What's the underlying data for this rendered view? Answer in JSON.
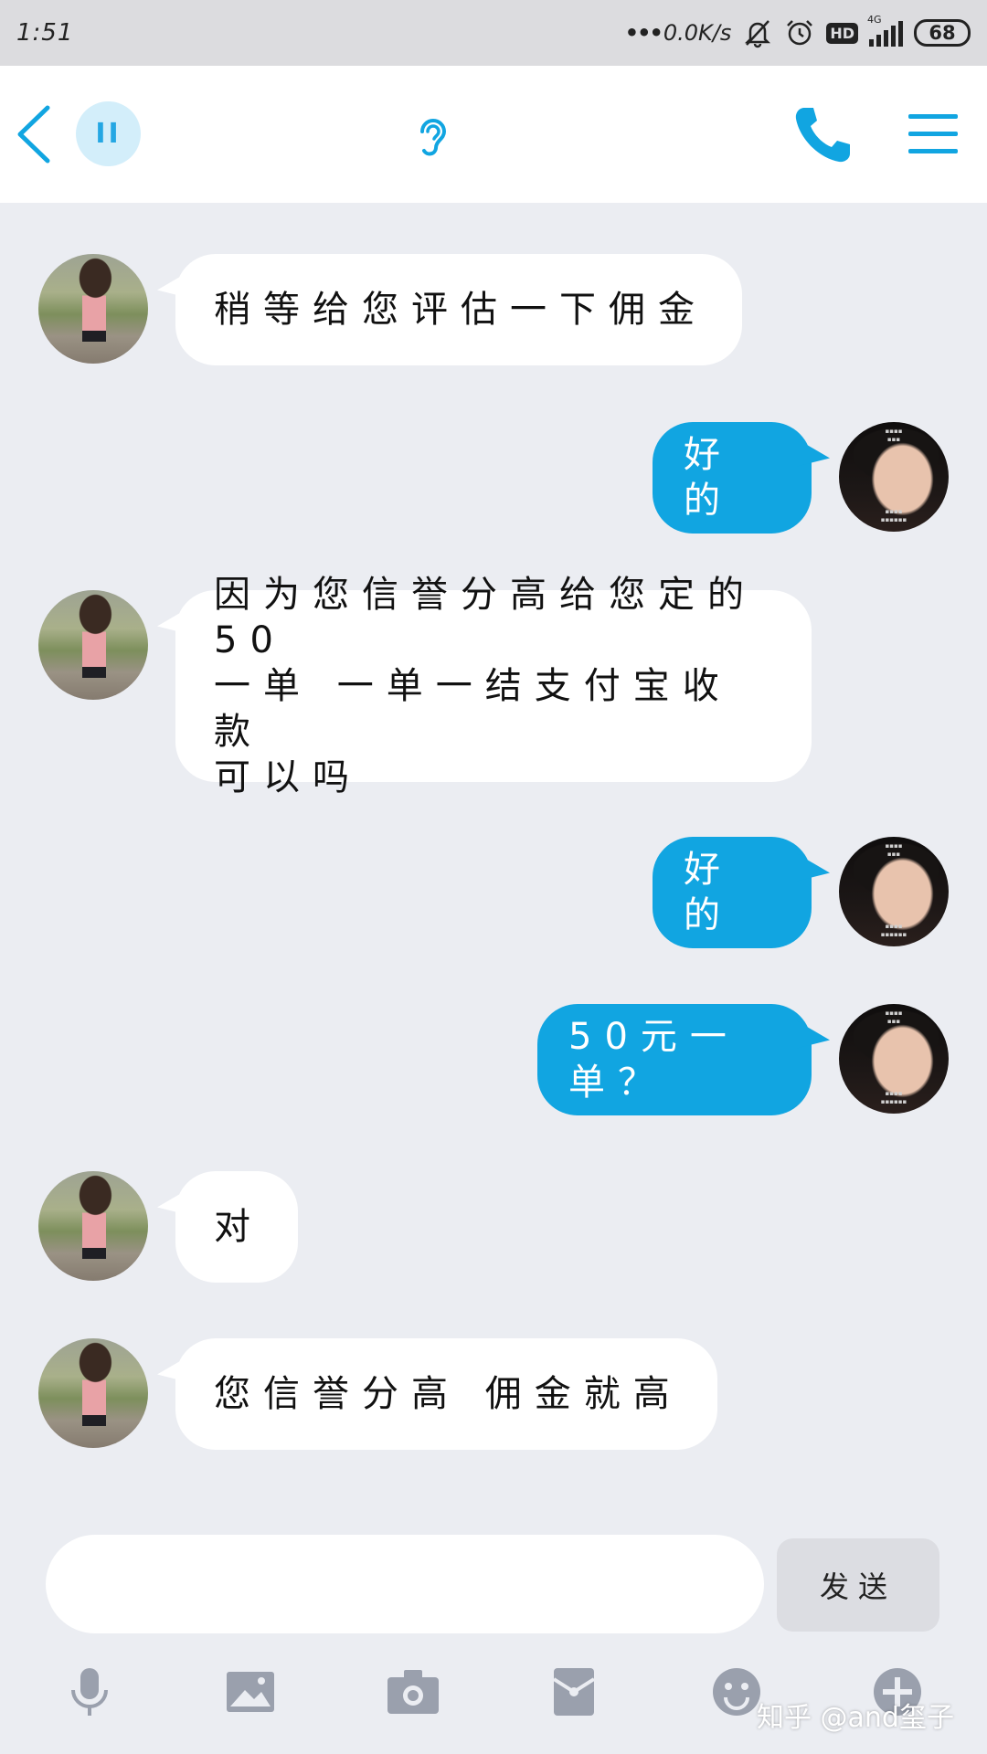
{
  "status_bar": {
    "time": "1:51",
    "net_speed": "0.0K/s",
    "hd_label": "HD",
    "network_tag": "4G",
    "battery": "68"
  },
  "title_bar": {
    "pause_label": "II"
  },
  "colors": {
    "accent": "#11a5e1",
    "background": "#ebedf2",
    "incoming_bubble": "#ffffff",
    "outgoing_bubble": "#11a5e1",
    "send_button": "#dcdde2"
  },
  "messages": [
    {
      "side": "left",
      "text": "稍等给您评估一下佣金"
    },
    {
      "side": "right",
      "text": "好的"
    },
    {
      "side": "left",
      "text": "因为您信誉分高给您定的50\n一单 一单一结支付宝收款\n可以吗"
    },
    {
      "side": "right",
      "text": "好的"
    },
    {
      "side": "right",
      "text": "50元一单？"
    },
    {
      "side": "left",
      "text": "对"
    },
    {
      "side": "left",
      "text": "您信誉分高 佣金就高"
    }
  ],
  "composer": {
    "input_value": "",
    "send_label": "发送"
  },
  "toolbar": {
    "icons": [
      "microphone-icon",
      "image-icon",
      "camera-icon",
      "red-packet-icon",
      "emoji-icon",
      "plus-icon"
    ]
  },
  "watermark": "知乎 @and玺子"
}
